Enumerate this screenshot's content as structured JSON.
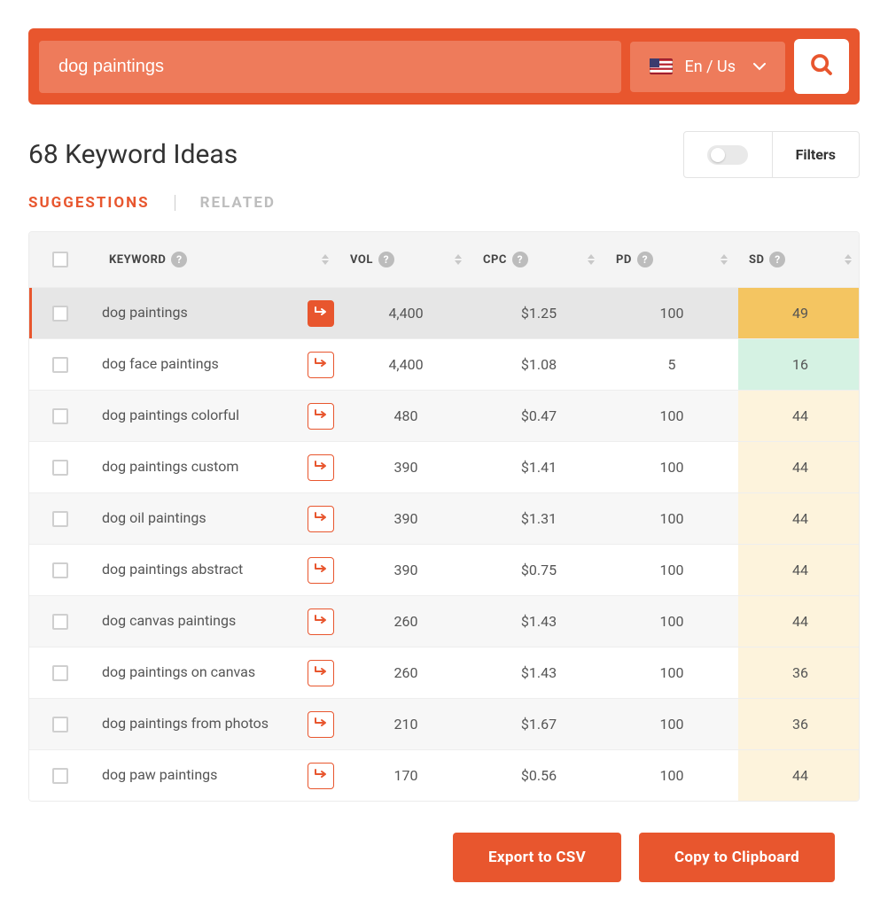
{
  "search": {
    "value": "dog paintings",
    "locale_label": "En / Us"
  },
  "header": {
    "title": "68 Keyword Ideas",
    "filters_label": "Filters"
  },
  "tabs": {
    "suggestions": "SUGGESTIONS",
    "related": "RELATED"
  },
  "columns": {
    "keyword": "KEYWORD",
    "vol": "VOL",
    "cpc": "CPC",
    "pd": "PD",
    "sd": "SD"
  },
  "rows": [
    {
      "keyword": "dog paintings",
      "vol": "4,400",
      "cpc": "$1.25",
      "pd": "100",
      "sd": "49",
      "sd_class": "sd-49",
      "active": true,
      "btn": "solid"
    },
    {
      "keyword": "dog face paintings",
      "vol": "4,400",
      "cpc": "$1.08",
      "pd": "5",
      "sd": "16",
      "sd_class": "sd-16",
      "active": false,
      "btn": "outline"
    },
    {
      "keyword": "dog paintings colorful",
      "vol": "480",
      "cpc": "$0.47",
      "pd": "100",
      "sd": "44",
      "sd_class": "sd-44",
      "active": false,
      "btn": "outline"
    },
    {
      "keyword": "dog paintings custom",
      "vol": "390",
      "cpc": "$1.41",
      "pd": "100",
      "sd": "44",
      "sd_class": "sd-44",
      "active": false,
      "btn": "outline"
    },
    {
      "keyword": "dog oil paintings",
      "vol": "390",
      "cpc": "$1.31",
      "pd": "100",
      "sd": "44",
      "sd_class": "sd-44",
      "active": false,
      "btn": "outline"
    },
    {
      "keyword": "dog paintings abstract",
      "vol": "390",
      "cpc": "$0.75",
      "pd": "100",
      "sd": "44",
      "sd_class": "sd-44",
      "active": false,
      "btn": "outline"
    },
    {
      "keyword": "dog canvas paintings",
      "vol": "260",
      "cpc": "$1.43",
      "pd": "100",
      "sd": "44",
      "sd_class": "sd-44",
      "active": false,
      "btn": "outline"
    },
    {
      "keyword": "dog paintings on canvas",
      "vol": "260",
      "cpc": "$1.43",
      "pd": "100",
      "sd": "36",
      "sd_class": "sd-36",
      "active": false,
      "btn": "outline"
    },
    {
      "keyword": "dog paintings from photos",
      "vol": "210",
      "cpc": "$1.67",
      "pd": "100",
      "sd": "36",
      "sd_class": "sd-36",
      "active": false,
      "btn": "outline"
    },
    {
      "keyword": "dog paw paintings",
      "vol": "170",
      "cpc": "$0.56",
      "pd": "100",
      "sd": "44",
      "sd_class": "sd-44",
      "active": false,
      "btn": "outline"
    }
  ],
  "footer": {
    "export_csv": "Export to CSV",
    "copy_clipboard": "Copy to Clipboard"
  }
}
